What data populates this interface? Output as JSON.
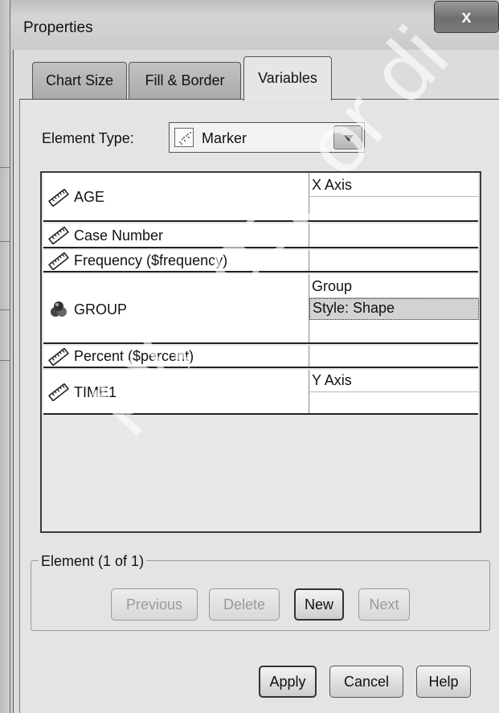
{
  "window": {
    "title": "Properties",
    "close_glyph": "x"
  },
  "tabs": [
    {
      "label": "Chart Size",
      "active": false
    },
    {
      "label": "Fill & Border",
      "active": false
    },
    {
      "label": "Variables",
      "active": true
    }
  ],
  "element_type": {
    "label": "Element Type:",
    "value": "Marker",
    "icon": "marker-scatter-icon"
  },
  "variables": [
    {
      "name": "AGE",
      "icon": "ruler-icon",
      "slots": [
        "X Axis",
        ""
      ]
    },
    {
      "name": "Case Number",
      "icon": "ruler-icon",
      "slots": []
    },
    {
      "name": "Frequency ($frequency)",
      "icon": "ruler-icon",
      "slots": []
    },
    {
      "name": "GROUP",
      "icon": "nominal-balls-icon",
      "slots": [
        "Group",
        "Style: Shape"
      ],
      "selected_slot": 1
    },
    {
      "name": "Percent ($percent)",
      "icon": "ruler-icon",
      "slots": []
    },
    {
      "name": "TIME1",
      "icon": "ruler-icon",
      "slots": [
        "Y Axis",
        ""
      ]
    }
  ],
  "element_group": {
    "title": "Element (1 of 1)",
    "buttons": [
      {
        "label": "Previous",
        "enabled": false
      },
      {
        "label": "Delete",
        "enabled": false
      },
      {
        "label": "New",
        "enabled": true
      },
      {
        "label": "Next",
        "enabled": false
      }
    ]
  },
  "footer": {
    "apply": "Apply",
    "cancel": "Cancel",
    "help": "Help"
  },
  "watermark": "py, post, or di",
  "colors": {
    "selected_slot_bg": "#d2d2d2",
    "table_bg": "#e8e8e8"
  }
}
